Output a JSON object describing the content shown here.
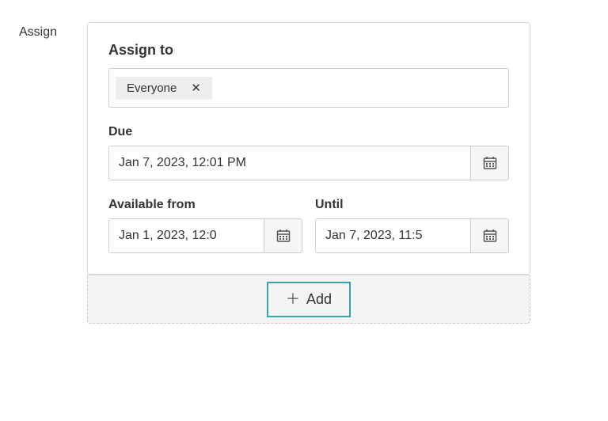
{
  "sideLabel": "Assign",
  "assignTo": {
    "label": "Assign to",
    "tokens": [
      "Everyone"
    ]
  },
  "due": {
    "label": "Due",
    "value": "Jan 7, 2023, 12:01 PM"
  },
  "availableFrom": {
    "label": "Available from",
    "value": "Jan 1, 2023, 12:0"
  },
  "until": {
    "label": "Until",
    "value": "Jan 7, 2023, 11:5"
  },
  "addButton": {
    "label": "Add"
  }
}
